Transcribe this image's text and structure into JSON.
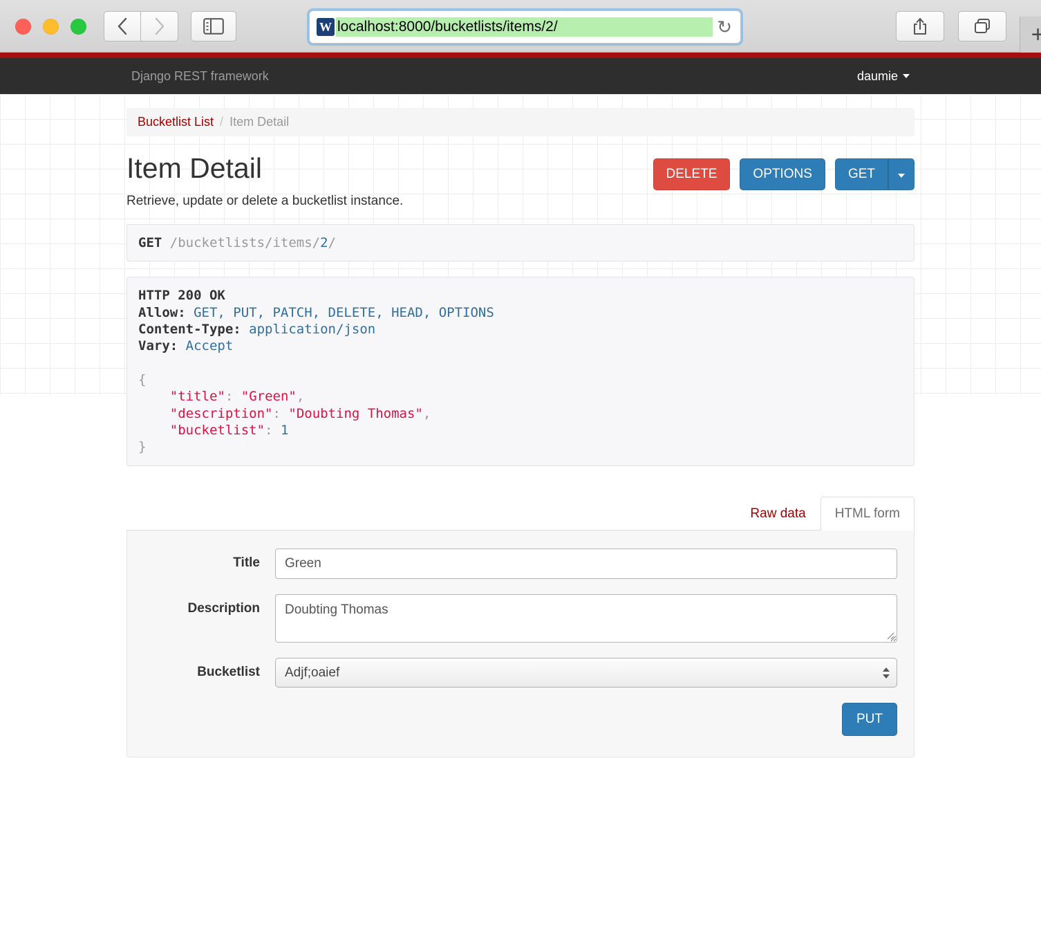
{
  "browser": {
    "url": "localhost:8000/bucketlists/items/2/",
    "favicon_letter": "W",
    "back_icon": "back-chevron-icon",
    "forward_icon": "forward-chevron-icon",
    "sidebar_icon": "sidebar-toggle-icon",
    "reload_icon": "↻",
    "share_icon": "share-icon",
    "tabs_icon": "tab-overview-icon",
    "newtab_label": "+"
  },
  "navbar": {
    "brand": "Django REST framework",
    "user": "daumie",
    "accent_color": "#a41010",
    "background_color": "#2e2e2e"
  },
  "breadcrumb": {
    "parent": "Bucketlist List",
    "separator": "/",
    "current": "Item Detail"
  },
  "header": {
    "title": "Item Detail",
    "description": "Retrieve, update or delete a bucketlist instance.",
    "buttons": {
      "delete": "DELETE",
      "options": "OPTIONS",
      "get": "GET"
    },
    "colors": {
      "danger": "#dd4b41",
      "primary": "#2e7db6"
    }
  },
  "request": {
    "method": "GET",
    "path_prefix": "/bucketlists/items/",
    "path_id": "2",
    "path_suffix": "/"
  },
  "response": {
    "status_line": "HTTP 200 OK",
    "headers": [
      {
        "name": "Allow:",
        "value": "GET, PUT, PATCH, DELETE, HEAD, OPTIONS"
      },
      {
        "name": "Content-Type:",
        "value": "application/json"
      },
      {
        "name": "Vary:",
        "value": "Accept"
      }
    ],
    "body": {
      "open_brace": "{",
      "close_brace": "}",
      "fields": [
        {
          "key": "\"title\"",
          "colon": ":",
          "value": "\"Green\"",
          "type": "string",
          "comma": ","
        },
        {
          "key": "\"description\"",
          "colon": ":",
          "value": "\"Doubting Thomas\"",
          "type": "string",
          "comma": ","
        },
        {
          "key": "\"bucketlist\"",
          "colon": ":",
          "value": "1",
          "type": "number",
          "comma": ""
        }
      ]
    }
  },
  "tabs": {
    "raw_data": "Raw data",
    "html_form": "HTML form",
    "active": "HTML form"
  },
  "form": {
    "title_label": "Title",
    "title_value": "Green",
    "description_label": "Description",
    "description_value": "Doubting Thomas",
    "bucketlist_label": "Bucketlist",
    "bucketlist_value": "Adjf;oaief",
    "submit_label": "PUT"
  }
}
